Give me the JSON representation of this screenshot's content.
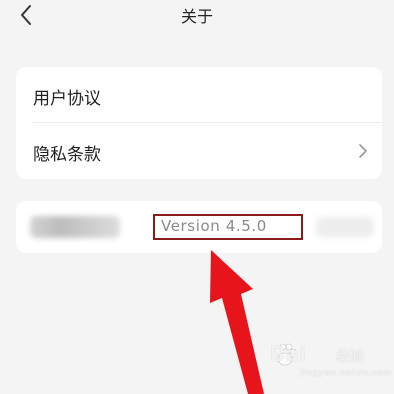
{
  "header": {
    "title": "关于",
    "back_icon": "chevron-left-icon"
  },
  "menu": {
    "items": [
      {
        "label": "用户协议"
      },
      {
        "label": "隐私条款",
        "icon": "chevron-right-icon"
      }
    ]
  },
  "version": {
    "text": "Version 4.5.0"
  },
  "annotation": {
    "highlight_color": "#8b1a1a",
    "arrow_color": "#e8141b"
  },
  "watermark": {
    "brand": "Bai",
    "name": "经验",
    "url": "jingyan.baidu.com"
  }
}
